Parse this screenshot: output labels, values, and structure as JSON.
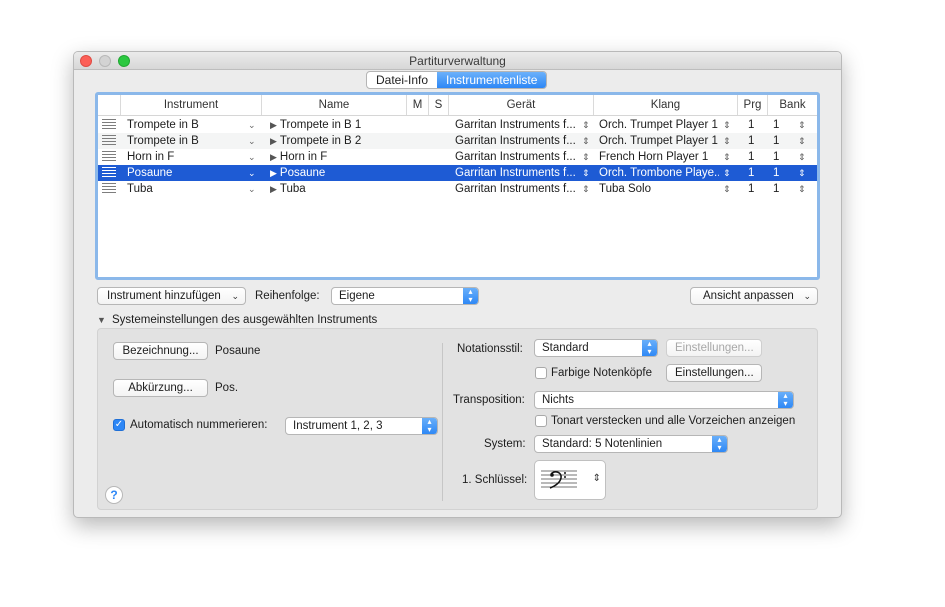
{
  "window": {
    "title": "Partiturverwaltung"
  },
  "tabs": [
    {
      "label": "Datei-Info",
      "active": false
    },
    {
      "label": "Instrumentenliste",
      "active": true
    }
  ],
  "table": {
    "headers": [
      "Instrument",
      "Name",
      "M",
      "S",
      "Gerät",
      "Klang",
      "Prg",
      "Bank"
    ],
    "rows": [
      {
        "instrument": "Trompete in B",
        "name": "Trompete in B 1",
        "geraet": "Garritan Instruments f...",
        "klang": "Orch. Trumpet Player 1",
        "prg": "1",
        "bank": "1",
        "selected": false
      },
      {
        "instrument": "Trompete in B",
        "name": "Trompete in B 2",
        "geraet": "Garritan Instruments f...",
        "klang": "Orch. Trumpet Player 1",
        "prg": "1",
        "bank": "1",
        "selected": false
      },
      {
        "instrument": "Horn in F",
        "name": "Horn in F",
        "geraet": "Garritan Instruments f...",
        "klang": "French Horn Player 1",
        "prg": "1",
        "bank": "1",
        "selected": false
      },
      {
        "instrument": "Posaune",
        "name": "Posaune",
        "geraet": "Garritan Instruments f...",
        "klang": "Orch. Trombone Playe...",
        "prg": "1",
        "bank": "1",
        "selected": true
      },
      {
        "instrument": "Tuba",
        "name": "Tuba",
        "geraet": "Garritan Instruments f...",
        "klang": "Tuba Solo",
        "prg": "1",
        "bank": "1",
        "selected": false
      }
    ]
  },
  "controls": {
    "add_instrument": "Instrument hinzufügen",
    "order_label": "Reihenfolge:",
    "order_value": "Eigene",
    "adjust_view": "Ansicht anpassen"
  },
  "settings": {
    "section_title": "Systemeinstellungen des ausgewählten Instruments",
    "bezeichnung_button": "Bezeichnung...",
    "bezeichnung_value": "Posaune",
    "abkuerzung_button": "Abkürzung...",
    "abkuerzung_value": "Pos.",
    "auto_number_label": "Automatisch nummerieren:",
    "auto_number_checked": true,
    "auto_number_value": "Instrument 1, 2, 3",
    "notation_label": "Notationsstil:",
    "notation_value": "Standard",
    "notation_settings_button": "Einstellungen...",
    "colored_heads_label": "Farbige Notenköpfe",
    "colored_heads_checked": false,
    "colored_heads_settings_button": "Einstellungen...",
    "transposition_label": "Transposition:",
    "transposition_value": "Nichts",
    "hide_key_label": "Tonart verstecken und alle Vorzeichen anzeigen",
    "hide_key_checked": false,
    "system_label": "System:",
    "system_value": "Standard: 5 Notenlinien",
    "clef_label": "1. Schlüssel:",
    "help_glyph": "?"
  },
  "colors": {
    "accent": "#2d87f6",
    "selection": "#1e5bd4"
  }
}
